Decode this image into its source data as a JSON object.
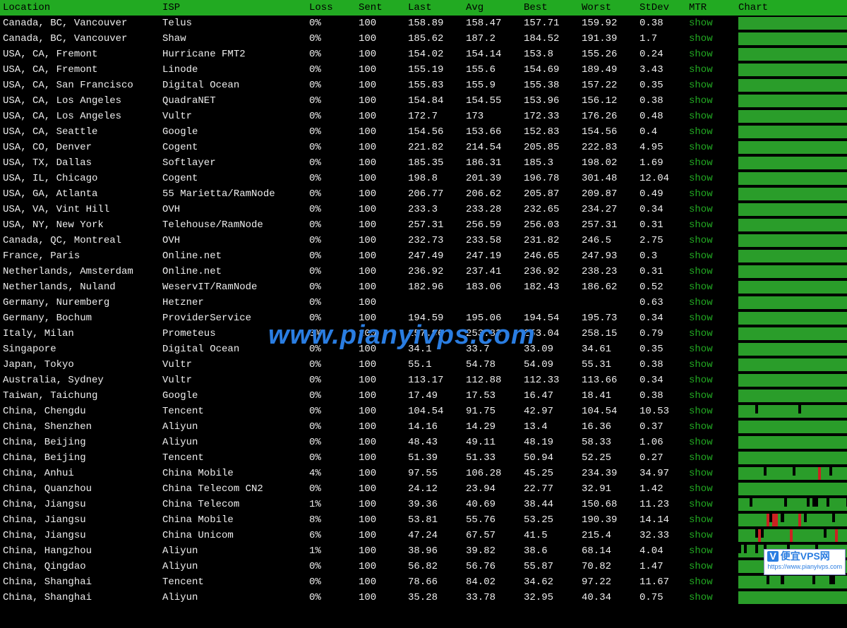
{
  "headers": {
    "location": "Location",
    "isp": "ISP",
    "loss": "Loss",
    "sent": "Sent",
    "last": "Last",
    "avg": "Avg",
    "best": "Best",
    "worst": "Worst",
    "stdev": "StDev",
    "mtr": "MTR",
    "chart": "Chart"
  },
  "mtr_label": "show",
  "watermark": "www.pianyivps.com",
  "badge": {
    "v": "V",
    "main": "便宜VPS网",
    "sub": "https://www.pianyivps.com"
  },
  "rows": [
    {
      "location": "Canada, BC, Vancouver",
      "isp": "Telus",
      "loss": "0%",
      "sent": "100",
      "last": "158.89",
      "avg": "158.47",
      "best": "157.71",
      "worst": "159.92",
      "stdev": "0.38",
      "chart": "flat"
    },
    {
      "location": "Canada, BC, Vancouver",
      "isp": "Shaw",
      "loss": "0%",
      "sent": "100",
      "last": "185.62",
      "avg": "187.2",
      "best": "184.52",
      "worst": "191.39",
      "stdev": "1.7",
      "chart": "flat"
    },
    {
      "location": "USA, CA, Fremont",
      "isp": "Hurricane FMT2",
      "loss": "0%",
      "sent": "100",
      "last": "154.02",
      "avg": "154.14",
      "best": "153.8",
      "worst": "155.26",
      "stdev": "0.24",
      "chart": "flat"
    },
    {
      "location": "USA, CA, Fremont",
      "isp": "Linode",
      "loss": "0%",
      "sent": "100",
      "last": "155.19",
      "avg": "155.6",
      "best": "154.69",
      "worst": "189.49",
      "stdev": "3.43",
      "chart": "flat"
    },
    {
      "location": "USA, CA, San Francisco",
      "isp": "Digital Ocean",
      "loss": "0%",
      "sent": "100",
      "last": "155.83",
      "avg": "155.9",
      "best": "155.38",
      "worst": "157.22",
      "stdev": "0.35",
      "chart": "flat"
    },
    {
      "location": "USA, CA, Los Angeles",
      "isp": "QuadraNET",
      "loss": "0%",
      "sent": "100",
      "last": "154.84",
      "avg": "154.55",
      "best": "153.96",
      "worst": "156.12",
      "stdev": "0.38",
      "chart": "flat"
    },
    {
      "location": "USA, CA, Los Angeles",
      "isp": "Vultr",
      "loss": "0%",
      "sent": "100",
      "last": "172.7",
      "avg": "173",
      "best": "172.33",
      "worst": "176.26",
      "stdev": "0.48",
      "chart": "flat"
    },
    {
      "location": "USA, CA, Seattle",
      "isp": "Google",
      "loss": "0%",
      "sent": "100",
      "last": "154.56",
      "avg": "153.66",
      "best": "152.83",
      "worst": "154.56",
      "stdev": "0.4",
      "chart": "flat"
    },
    {
      "location": "USA, CO, Denver",
      "isp": "Cogent",
      "loss": "0%",
      "sent": "100",
      "last": "221.82",
      "avg": "214.54",
      "best": "205.85",
      "worst": "222.83",
      "stdev": "4.95",
      "chart": "flat"
    },
    {
      "location": "USA, TX, Dallas",
      "isp": "Softlayer",
      "loss": "0%",
      "sent": "100",
      "last": "185.35",
      "avg": "186.31",
      "best": "185.3",
      "worst": "198.02",
      "stdev": "1.69",
      "chart": "flat"
    },
    {
      "location": "USA, IL, Chicago",
      "isp": "Cogent",
      "loss": "0%",
      "sent": "100",
      "last": "198.8",
      "avg": "201.39",
      "best": "196.78",
      "worst": "301.48",
      "stdev": "12.04",
      "chart": "flat"
    },
    {
      "location": "USA, GA, Atlanta",
      "isp": "55 Marietta/RamNode",
      "loss": "0%",
      "sent": "100",
      "last": "206.77",
      "avg": "206.62",
      "best": "205.87",
      "worst": "209.87",
      "stdev": "0.49",
      "chart": "flat"
    },
    {
      "location": "USA, VA, Vint Hill",
      "isp": "OVH",
      "loss": "0%",
      "sent": "100",
      "last": "233.3",
      "avg": "233.28",
      "best": "232.65",
      "worst": "234.27",
      "stdev": "0.34",
      "chart": "flat"
    },
    {
      "location": "USA, NY, New York",
      "isp": "Telehouse/RamNode",
      "loss": "0%",
      "sent": "100",
      "last": "257.31",
      "avg": "256.59",
      "best": "256.03",
      "worst": "257.31",
      "stdev": "0.31",
      "chart": "flat"
    },
    {
      "location": "Canada, QC, Montreal",
      "isp": "OVH",
      "loss": "0%",
      "sent": "100",
      "last": "232.73",
      "avg": "233.58",
      "best": "231.82",
      "worst": "246.5",
      "stdev": "2.75",
      "chart": "flat"
    },
    {
      "location": "France, Paris",
      "isp": "Online.net",
      "loss": "0%",
      "sent": "100",
      "last": "247.49",
      "avg": "247.19",
      "best": "246.65",
      "worst": "247.93",
      "stdev": "0.3",
      "chart": "flat"
    },
    {
      "location": "Netherlands, Amsterdam",
      "isp": "Online.net",
      "loss": "0%",
      "sent": "100",
      "last": "236.92",
      "avg": "237.41",
      "best": "236.92",
      "worst": "238.23",
      "stdev": "0.31",
      "chart": "flat"
    },
    {
      "location": "Netherlands, Nuland",
      "isp": "WeservIT/RamNode",
      "loss": "0%",
      "sent": "100",
      "last": "182.96",
      "avg": "183.06",
      "best": "182.43",
      "worst": "186.62",
      "stdev": "0.52",
      "chart": "flat"
    },
    {
      "location": "Germany, Nuremberg",
      "isp": "Hetzner",
      "loss": "0%",
      "sent": "100",
      "last": "",
      "avg": "",
      "best": "",
      "worst": "",
      "stdev": "0.63",
      "chart": "flat"
    },
    {
      "location": "Germany, Bochum",
      "isp": "ProviderService",
      "loss": "0%",
      "sent": "100",
      "last": "194.59",
      "avg": "195.06",
      "best": "194.54",
      "worst": "195.73",
      "stdev": "0.34",
      "chart": "flat"
    },
    {
      "location": "Italy, Milan",
      "isp": "Prometeus",
      "loss": "0%",
      "sent": "100",
      "last": "257.96",
      "avg": "253.83",
      "best": "253.04",
      "worst": "258.15",
      "stdev": "0.79",
      "chart": "flat"
    },
    {
      "location": "Singapore",
      "isp": "Digital Ocean",
      "loss": "0%",
      "sent": "100",
      "last": "34.1",
      "avg": "33.7",
      "best": "33.09",
      "worst": "34.61",
      "stdev": "0.35",
      "chart": "flat"
    },
    {
      "location": "Japan, Tokyo",
      "isp": "Vultr",
      "loss": "0%",
      "sent": "100",
      "last": "55.1",
      "avg": "54.78",
      "best": "54.09",
      "worst": "55.31",
      "stdev": "0.38",
      "chart": "flat"
    },
    {
      "location": "Australia, Sydney",
      "isp": "Vultr",
      "loss": "0%",
      "sent": "100",
      "last": "113.17",
      "avg": "112.88",
      "best": "112.33",
      "worst": "113.66",
      "stdev": "0.34",
      "chart": "flat"
    },
    {
      "location": "Taiwan, Taichung",
      "isp": "Google",
      "loss": "0%",
      "sent": "100",
      "last": "17.49",
      "avg": "17.53",
      "best": "16.47",
      "worst": "18.41",
      "stdev": "0.38",
      "chart": "flat"
    },
    {
      "location": "China, Chengdu",
      "isp": "Tencent",
      "loss": "0%",
      "sent": "100",
      "last": "104.54",
      "avg": "91.75",
      "best": "42.97",
      "worst": "104.54",
      "stdev": "10.53",
      "chart": "noisy"
    },
    {
      "location": "China, Shenzhen",
      "isp": "Aliyun",
      "loss": "0%",
      "sent": "100",
      "last": "14.16",
      "avg": "14.29",
      "best": "13.4",
      "worst": "16.36",
      "stdev": "0.37",
      "chart": "flat"
    },
    {
      "location": "China, Beijing",
      "isp": "Aliyun",
      "loss": "0%",
      "sent": "100",
      "last": "48.43",
      "avg": "49.11",
      "best": "48.19",
      "worst": "58.33",
      "stdev": "1.06",
      "chart": "flat"
    },
    {
      "location": "China, Beijing",
      "isp": "Tencent",
      "loss": "0%",
      "sent": "100",
      "last": "51.39",
      "avg": "51.33",
      "best": "50.94",
      "worst": "52.25",
      "stdev": "0.27",
      "chart": "flat"
    },
    {
      "location": "China, Anhui",
      "isp": "China Mobile",
      "loss": "4%",
      "sent": "100",
      "last": "97.55",
      "avg": "106.28",
      "best": "45.25",
      "worst": "234.39",
      "stdev": "34.97",
      "chart": "loss"
    },
    {
      "location": "China, Quanzhou",
      "isp": "China Telecom CN2",
      "loss": "0%",
      "sent": "100",
      "last": "24.12",
      "avg": "23.94",
      "best": "22.77",
      "worst": "32.91",
      "stdev": "1.42",
      "chart": "flat"
    },
    {
      "location": "China, Jiangsu",
      "isp": "China Telecom",
      "loss": "1%",
      "sent": "100",
      "last": "39.36",
      "avg": "40.69",
      "best": "38.44",
      "worst": "150.68",
      "stdev": "11.23",
      "chart": "noisy"
    },
    {
      "location": "China, Jiangsu",
      "isp": "China Mobile",
      "loss": "8%",
      "sent": "100",
      "last": "53.81",
      "avg": "55.76",
      "best": "53.25",
      "worst": "190.39",
      "stdev": "14.14",
      "chart": "loss"
    },
    {
      "location": "China, Jiangsu",
      "isp": "China Unicom",
      "loss": "6%",
      "sent": "100",
      "last": "47.24",
      "avg": "67.57",
      "best": "41.5",
      "worst": "215.4",
      "stdev": "32.33",
      "chart": "loss"
    },
    {
      "location": "China, Hangzhou",
      "isp": "Aliyun",
      "loss": "1%",
      "sent": "100",
      "last": "38.96",
      "avg": "39.82",
      "best": "38.6",
      "worst": "68.14",
      "stdev": "4.04",
      "chart": "noisy"
    },
    {
      "location": "China, Qingdao",
      "isp": "Aliyun",
      "loss": "0%",
      "sent": "100",
      "last": "56.82",
      "avg": "56.76",
      "best": "55.87",
      "worst": "70.82",
      "stdev": "1.47",
      "chart": "flat"
    },
    {
      "location": "China, Shanghai",
      "isp": "Tencent",
      "loss": "0%",
      "sent": "100",
      "last": "78.66",
      "avg": "84.02",
      "best": "34.62",
      "worst": "97.22",
      "stdev": "11.67",
      "chart": "noisy"
    },
    {
      "location": "China, Shanghai",
      "isp": "Aliyun",
      "loss": "0%",
      "sent": "100",
      "last": "35.28",
      "avg": "33.78",
      "best": "32.95",
      "worst": "40.34",
      "stdev": "0.75",
      "chart": "flat"
    }
  ]
}
